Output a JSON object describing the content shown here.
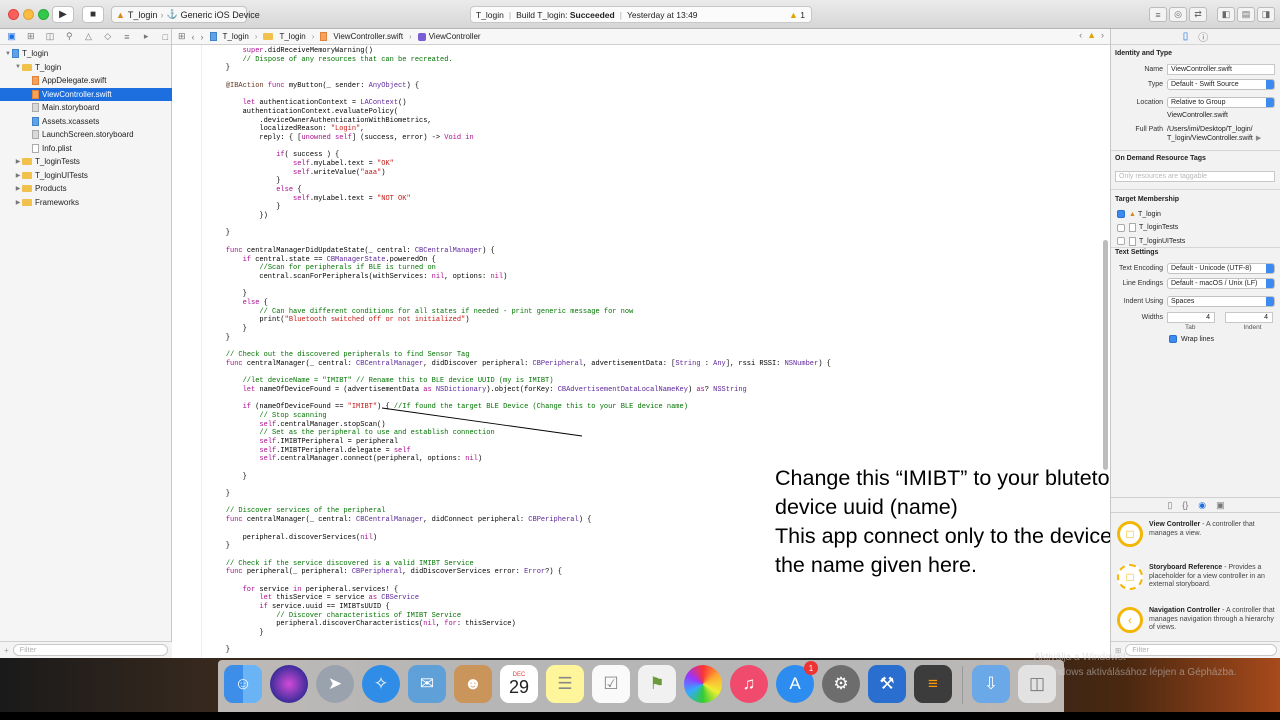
{
  "titlebar": {
    "scheme_target": "T_login",
    "scheme_device": "Generic iOS Device",
    "activity_project": "T_login",
    "activity_status_prefix": "Build T_login:",
    "activity_status": "Succeeded",
    "activity_time": "Yesterday at 13:49",
    "warning_count": "1"
  },
  "navigator": {
    "items": [
      {
        "label": "T_login",
        "depth": 0,
        "kind": "project",
        "expanded": true,
        "selected": false
      },
      {
        "label": "T_login",
        "depth": 1,
        "kind": "folder",
        "expanded": true,
        "selected": false
      },
      {
        "label": "AppDelegate.swift",
        "depth": 2,
        "kind": "swift",
        "selected": false
      },
      {
        "label": "ViewController.swift",
        "depth": 2,
        "kind": "swift",
        "selected": true
      },
      {
        "label": "Main.storyboard",
        "depth": 2,
        "kind": "sb",
        "selected": false
      },
      {
        "label": "Assets.xcassets",
        "depth": 2,
        "kind": "xc",
        "selected": false
      },
      {
        "label": "LaunchScreen.storyboard",
        "depth": 2,
        "kind": "sb",
        "selected": false
      },
      {
        "label": "Info.plist",
        "depth": 2,
        "kind": "file",
        "selected": false
      },
      {
        "label": "T_loginTests",
        "depth": 1,
        "kind": "folder",
        "expanded": false,
        "selected": false
      },
      {
        "label": "T_loginUITests",
        "depth": 1,
        "kind": "folder",
        "expanded": false,
        "selected": false
      },
      {
        "label": "Products",
        "depth": 1,
        "kind": "folder",
        "expanded": false,
        "selected": false
      },
      {
        "label": "Frameworks",
        "depth": 1,
        "kind": "folder",
        "expanded": false,
        "selected": false
      }
    ],
    "filter_placeholder": "Filter"
  },
  "jumpbar": {
    "crumbs": [
      "T_login",
      "T_login",
      "ViewController.swift",
      "ViewController"
    ]
  },
  "code_lines": [
    "        super.didReceiveMemoryWarning()",
    "        // Dispose of any resources that can be recreated.",
    "    }",
    "",
    "    @IBAction func myButton(_ sender: AnyObject) {",
    "",
    "        let authenticationContext = LAContext()",
    "        authenticationContext.evaluatePolicy(",
    "            .deviceOwnerAuthenticationWithBiometrics,",
    "            localizedReason: \"Login\",",
    "            reply: { [unowned self] (success, error) -> Void in",
    "",
    "                if( success ) {",
    "                    self.myLabel.text = \"OK\"",
    "                    self.writeValue(\"aaa\")",
    "                }",
    "                else {",
    "                    self.myLabel.text = \"NOT OK\"",
    "                }",
    "            })",
    "",
    "    }",
    "",
    "    func centralManagerDidUpdateState(_ central: CBCentralManager) {",
    "        if central.state == CBManagerState.poweredOn {",
    "            //Scan for peripherals if BLE is turned on",
    "            central.scanForPeripherals(withServices: nil, options: nil)",
    "",
    "        }",
    "        else {",
    "            // Can have different conditions for all states if needed - print generic message for now",
    "            print(\"Bluetooth switched off or not initialized\")",
    "        }",
    "    }",
    "",
    "    // Check out the discovered peripherals to find Sensor Tag",
    "    func centralManager(_ central: CBCentralManager, didDiscover peripheral: CBPeripheral, advertisementData: [String : Any], rssi RSSI: NSNumber) {",
    "",
    "        //let deviceName = \"IMIBT\" // Rename this to BLE device UUID (my is IMIBT)",
    "        let nameOfDeviceFound = (advertisementData as NSDictionary).object(forKey: CBAdvertisementDataLocalNameKey) as? NSString",
    "",
    "        if (nameOfDeviceFound == \"IMIBT\") { //If found the target BLE Device (Change this to your BLE device name)",
    "            // Stop scanning",
    "            self.centralManager.stopScan()",
    "            // Set as the peripheral to use and establish connection",
    "            self.IMIBTPeripheral = peripheral",
    "            self.IMIBTPeripheral.delegate = self",
    "            self.centralManager.connect(peripheral, options: nil)",
    "",
    "        }",
    "",
    "    }",
    "",
    "    // Discover services of the peripheral",
    "    func centralManager(_ central: CBCentralManager, didConnect peripheral: CBPeripheral) {",
    "",
    "        peripheral.discoverServices(nil)",
    "    }",
    "",
    "    // Check if the service discovered is a valid IMIBT Service",
    "    func peripheral(_ peripheral: CBPeripheral, didDiscoverServices error: Error?) {",
    "",
    "        for service in peripheral.services! {",
    "            let thisService = service as CBService",
    "            if service.uuid == IMIBTsUUID {",
    "                // Discover characteristics of IMIBT Service",
    "                peripheral.discoverCharacteristics(nil, for: thisService)",
    "            }",
    "",
    "    }"
  ],
  "annotation": {
    "lines": [
      "Change this “IMIBT” to your blutetooth",
      "device uuid (name)",
      "This app connect only to the device with",
      "the name given here."
    ]
  },
  "inspector": {
    "identity_title": "Identity and Type",
    "name_label": "Name",
    "name_value": "ViewController.swift",
    "type_label": "Type",
    "type_value": "Default - Swift Source",
    "location_label": "Location",
    "location_value": "Relative to Group",
    "location_file": "ViewController.swift",
    "fullpath_label": "Full Path",
    "fullpath_value_1": "/Users/imi/Desktop/T_login/",
    "fullpath_value_2": "T_login/ViewController.swift",
    "odr_title": "On Demand Resource Tags",
    "odr_placeholder": "Only resources are taggable",
    "membership_title": "Target Membership",
    "targets": [
      {
        "label": "T_login",
        "checked": true
      },
      {
        "label": "T_loginTests",
        "checked": false
      },
      {
        "label": "T_loginUITests",
        "checked": false
      }
    ],
    "text_settings_title": "Text Settings",
    "encoding_label": "Text Encoding",
    "encoding_value": "Default - Unicode (UTF-8)",
    "line_endings_label": "Line Endings",
    "line_endings_value": "Default - macOS / Unix (LF)",
    "indent_using_label": "Indent Using",
    "indent_using_value": "Spaces",
    "widths_label": "Widths",
    "tab_value": "4",
    "indent_value": "4",
    "tab_label": "Tab",
    "indent_label": "Indent",
    "wrap_label": "Wrap lines",
    "library": [
      {
        "title": "View Controller",
        "desc": " - A controller that manages a view."
      },
      {
        "title": "Storyboard Reference",
        "desc": " - Provides a placeholder for a view controller in an external storyboard."
      },
      {
        "title": "Navigation Controller",
        "desc": " - A controller that manages navigation through a hierarchy of views."
      }
    ],
    "filter_placeholder": "Filter"
  },
  "dock": {
    "calendar_month": "DEC",
    "calendar_day": "29",
    "appstore_badge": "1"
  },
  "watermark": {
    "line1": "Aktiválja a Windowst",
    "line2": "A Windows aktiválásához lépjen a Gépházba."
  },
  "colors": {
    "selection": "#1d6fe0",
    "keyword": "#aa0d91",
    "type": "#5c2699",
    "string": "#c41a16",
    "comment": "#007400"
  }
}
